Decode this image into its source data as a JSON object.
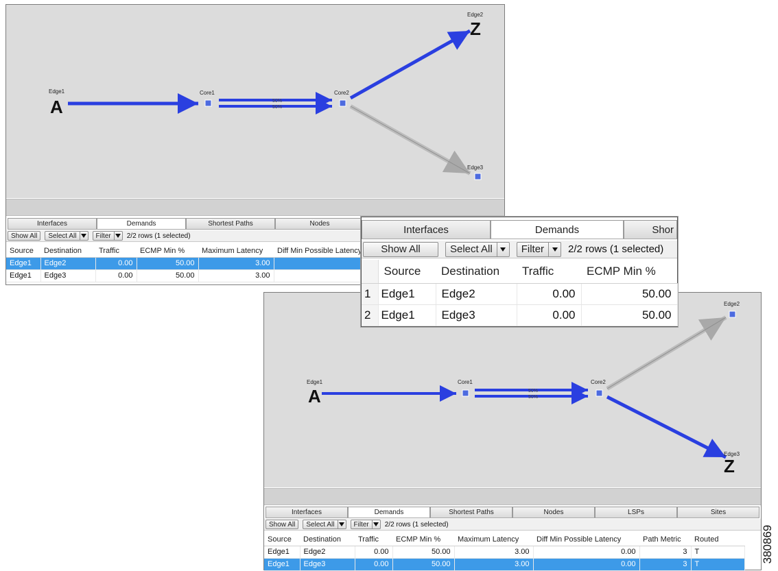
{
  "colors": {
    "demand_route": "#2a3fe0",
    "other_link": "#bcbcbc",
    "node": "#4d6bdf",
    "selection": "#3d9ae8"
  },
  "panel_a": {
    "nodes": {
      "edge1": "Edge1",
      "core1": "Core1",
      "core2": "Core2",
      "edge2": "Edge2",
      "edge3": "Edge3"
    },
    "markers": {
      "source": "A",
      "destination": "Z"
    },
    "ecmp_labels": [
      "50%",
      "50%"
    ],
    "tabs": [
      "Interfaces",
      "Demands",
      "Shortest Paths",
      "Nodes"
    ],
    "toolbar": {
      "show_all": "Show All",
      "select_all": "Select All",
      "filter": "Filter",
      "rows_status": "2/2 rows (1 selected)"
    },
    "table": {
      "headers": [
        "Source",
        "Destination",
        "Traffic",
        "ECMP Min %",
        "Maximum Latency",
        "Diff Min Possible Latency"
      ],
      "rows": [
        {
          "source": "Edge1",
          "destination": "Edge2",
          "traffic": "0.00",
          "ecmp_min": "50.00",
          "max_latency": "3.00",
          "diff_min": ""
        },
        {
          "source": "Edge1",
          "destination": "Edge3",
          "traffic": "0.00",
          "ecmp_min": "50.00",
          "max_latency": "3.00",
          "diff_min": ""
        }
      ],
      "selected_row": 0
    }
  },
  "zoom": {
    "tabs": [
      "Interfaces",
      "Demands",
      "Shor"
    ],
    "toolbar": {
      "show_all": "Show All",
      "select_all": "Select All",
      "filter": "Filter",
      "rows_status": "2/2 rows (1 selected)"
    },
    "table": {
      "headers": [
        "Source",
        "Destination",
        "Traffic",
        "ECMP Min %"
      ],
      "rows": [
        {
          "index": "1",
          "source": "Edge1",
          "destination": "Edge2",
          "traffic": "0.00",
          "ecmp_min": "50.00"
        },
        {
          "index": "2",
          "source": "Edge1",
          "destination": "Edge3",
          "traffic": "0.00",
          "ecmp_min": "50.00"
        }
      ]
    }
  },
  "panel_b": {
    "nodes": {
      "edge1": "Edge1",
      "core1": "Core1",
      "core2": "Core2",
      "edge2": "Edge2",
      "edge3": "Edge3"
    },
    "markers": {
      "source": "A",
      "destination": "Z"
    },
    "ecmp_labels": [
      "50%",
      "50%"
    ],
    "tabs": [
      "Interfaces",
      "Demands",
      "Shortest Paths",
      "Nodes",
      "LSPs",
      "Sites"
    ],
    "toolbar": {
      "show_all": "Show All",
      "select_all": "Select All",
      "filter": "Filter",
      "rows_status": "2/2 rows (1 selected)"
    },
    "table": {
      "headers": [
        "Source",
        "Destination",
        "Traffic",
        "ECMP Min %",
        "Maximum Latency",
        "Diff Min Possible Latency",
        "Path Metric",
        "Routed"
      ],
      "rows": [
        {
          "source": "Edge1",
          "destination": "Edge2",
          "traffic": "0.00",
          "ecmp_min": "50.00",
          "max_latency": "3.00",
          "diff_min": "0.00",
          "path_metric": "3",
          "routed": "T"
        },
        {
          "source": "Edge1",
          "destination": "Edge3",
          "traffic": "0.00",
          "ecmp_min": "50.00",
          "max_latency": "3.00",
          "diff_min": "0.00",
          "path_metric": "3",
          "routed": "T"
        }
      ],
      "selected_row": 1
    }
  },
  "figure_id": "380869"
}
